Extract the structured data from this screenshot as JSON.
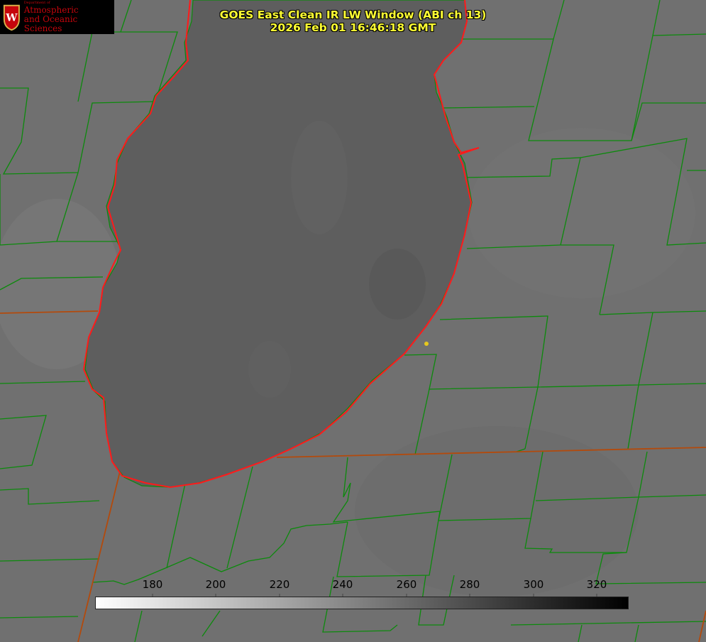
{
  "logo": {
    "dept": "Department of",
    "line1": "Atmospheric",
    "line2": "and Oceanic Sciences"
  },
  "title": {
    "line1": "GOES East Clean IR LW Window (ABI ch 13)",
    "line2": "2026 Feb 01 16:46:18 GMT"
  },
  "colorbar": {
    "ticks": [
      "180",
      "200",
      "220",
      "240",
      "260",
      "280",
      "300",
      "320"
    ],
    "colors": {
      "min": "#ffffff",
      "max": "#000000"
    }
  },
  "colors": {
    "land": "#6e6e6e",
    "lake": "#5c5c5c",
    "county": "#0c8a0c",
    "coast": "#ff1a1a",
    "state": "#b34a0c",
    "marker": "#e6c81e",
    "title": "#ffff33"
  }
}
